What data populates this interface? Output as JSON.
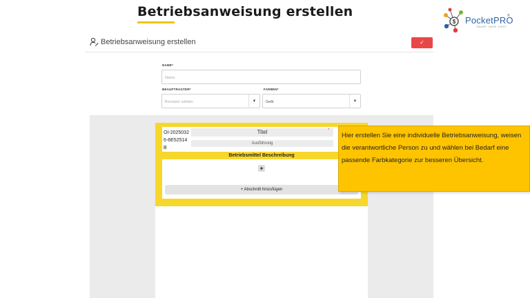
{
  "slide": {
    "title": "Betriebsanweisung erstellen"
  },
  "logo": {
    "brand": "PocketPRO",
    "registered": "®",
    "tagline": "SMART. SAFE. EASY."
  },
  "colors": {
    "accent_yellow": "#f7d72c",
    "tooltip_yellow": "#ffc400",
    "confirm_red": "#e94747",
    "logo_blue": "#2d63a5"
  },
  "app": {
    "header": {
      "icon": "person-edit-icon",
      "title": "Betriebsanweisung erstellen",
      "confirm_icon": "checkmark-icon",
      "confirm_glyph": "✓"
    },
    "form": {
      "name_label": "NAME*",
      "name_placeholder": "Name",
      "assignee_label": "BEAUFTRAGTER*",
      "assignee_placeholder": "Benutzer wählen",
      "color_label": "FARBEN*",
      "color_value": "Gelb",
      "dropdown_glyph": "▼"
    },
    "document": {
      "id": "OI-20250326-6E52514B",
      "title": "Titel",
      "required_mark": "*",
      "execution": "Ausführung",
      "band_label": "Betriebsmittel Beschreibung",
      "plus_glyph": "+",
      "add_section_label": "+ Abschnitt hinzufügen"
    }
  },
  "tooltip": {
    "text": "Hier erstellen Sie eine individuelle Betriebsanweisung, weisen die verantwortliche Person zu und wählen bei Bedarf eine passende Farbkategorie zur besseren Übersicht."
  }
}
